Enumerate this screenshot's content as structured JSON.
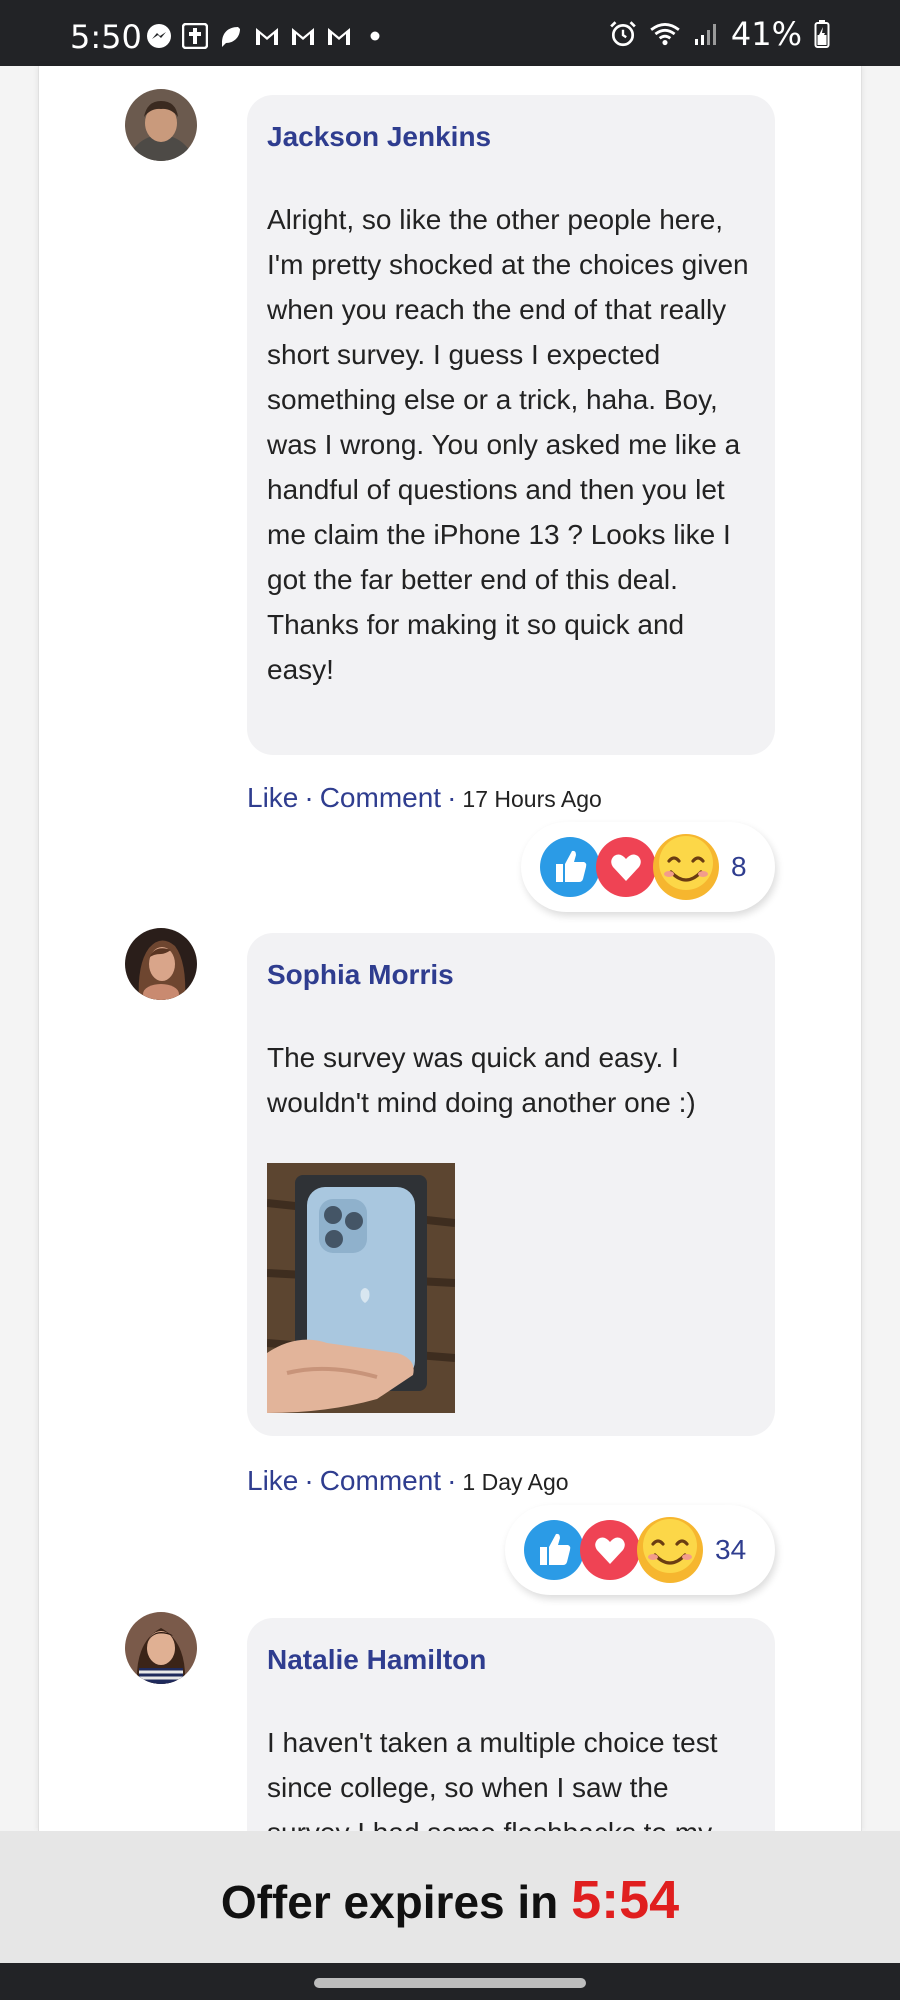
{
  "status_bar": {
    "time": "5:50",
    "battery": "41%",
    "left_icons": [
      "messenger-icon",
      "bible-app-icon",
      "chat-icon",
      "gmail-icon",
      "gmail-icon",
      "gmail-icon",
      "dot-icon"
    ],
    "right_icons": [
      "alarm-icon",
      "wifi-icon",
      "signal-icon",
      "battery-icon"
    ]
  },
  "comments": [
    {
      "author": "Jackson Jenkins",
      "text": "Alright, so like the other people here, I'm pretty shocked at the choices given when you reach the end of that really short survey. I guess I expected something else or a trick, haha. Boy, was I wrong. You only asked me like a handful of questions and then you let me claim the iPhone 13 ? Looks like I got the far better end of this deal. Thanks for making it so quick and easy!",
      "like_label": "Like",
      "comment_label": "Comment",
      "time": "17 Hours Ago",
      "reaction_count": "8"
    },
    {
      "author": "Sophia Morris",
      "text": "The survey was quick and easy. I wouldn't mind doing another one :)",
      "like_label": "Like",
      "comment_label": "Comment",
      "time": "1 Day Ago",
      "reaction_count": "34"
    },
    {
      "author": "Natalie Hamilton",
      "text": "I haven't taken a multiple choice test since college, so when I saw the survey I had some flashbacks to my"
    }
  ],
  "offer": {
    "label": "Offer expires in",
    "timer": "5:54"
  },
  "colors": {
    "accent": "#2f3d8f",
    "timer": "#e01f1f",
    "bubble": "#f2f2f4",
    "status_bar": "#222326"
  }
}
